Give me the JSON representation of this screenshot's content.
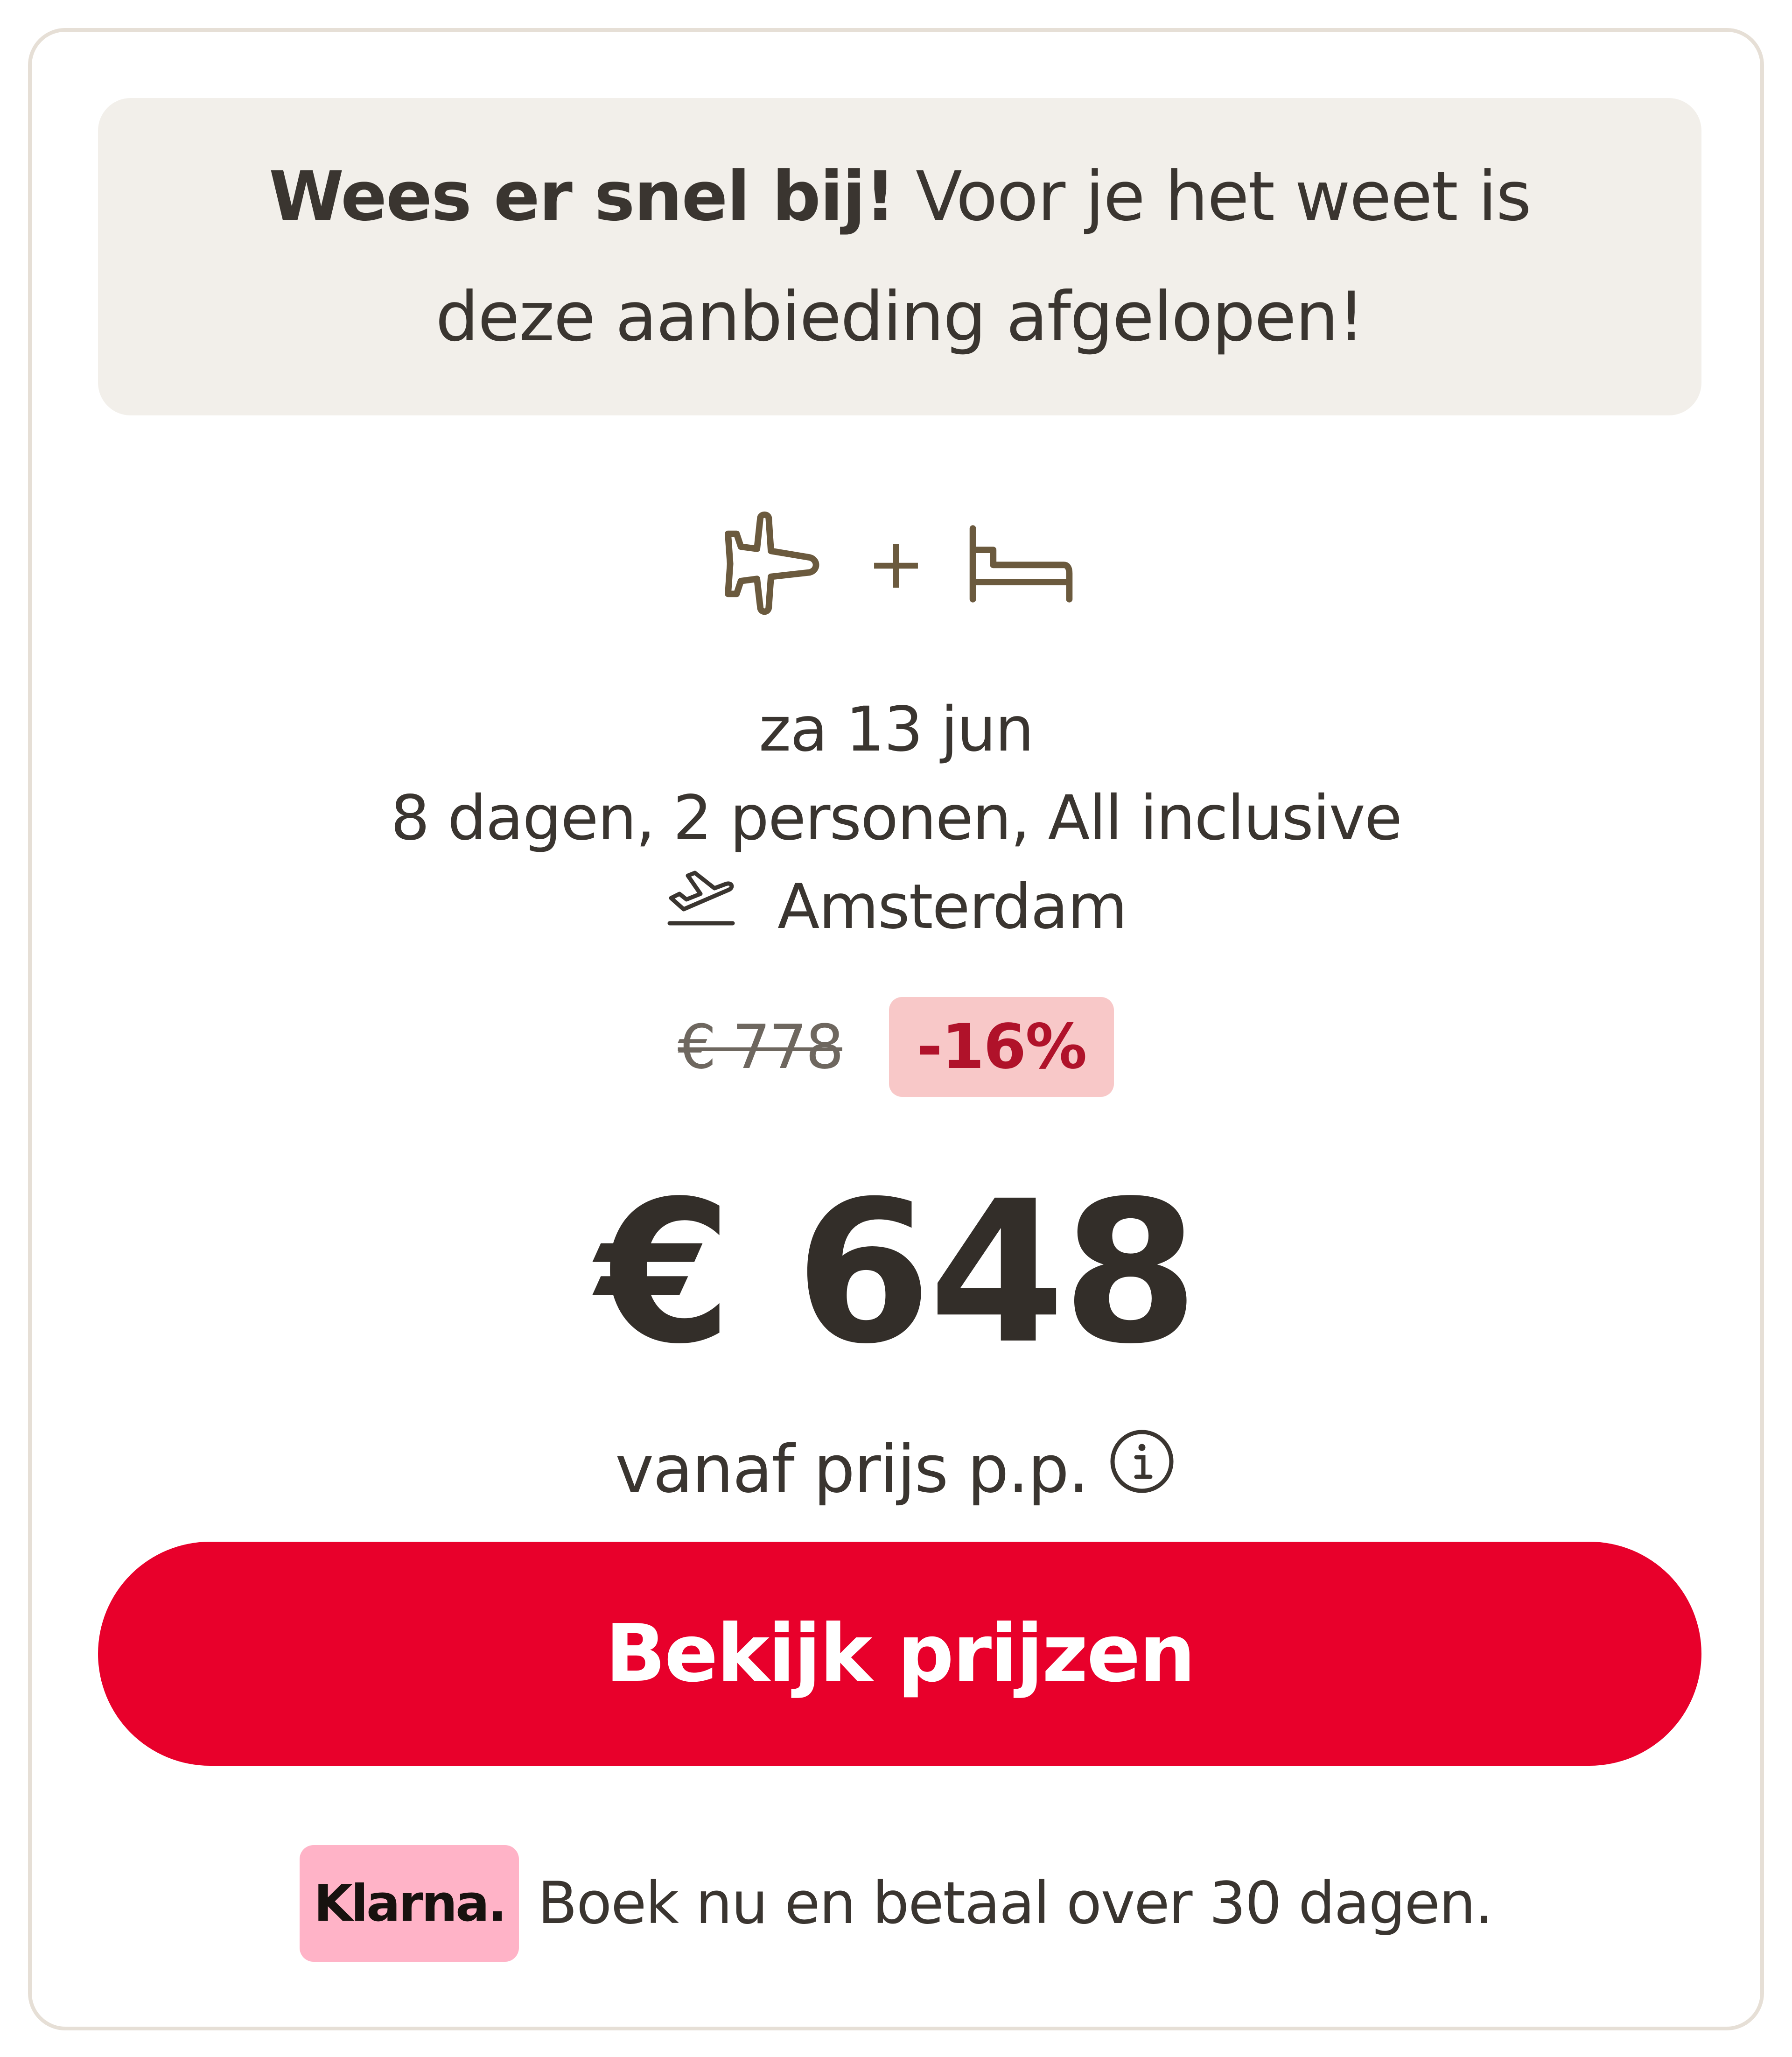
{
  "urgency": {
    "bold": "Wees er snel bij!",
    "text": "Voor je het weet is deze aanbieding afgelopen!"
  },
  "package": {
    "icons": [
      "airplane-icon",
      "bed-icon"
    ],
    "separator": "+"
  },
  "trip": {
    "date": "za 13 jun",
    "details": "8 dagen, 2 personen, All inclusive",
    "departure": "Amsterdam"
  },
  "pricing": {
    "old_price": "€ 778",
    "discount": "-16%",
    "price": "€ 648",
    "note": "vanaf prijs p.p."
  },
  "cta": {
    "label": "Bekijk prijzen"
  },
  "klarna": {
    "logo": "Klarna.",
    "text": "Boek nu en betaal over 30 dagen."
  },
  "colors": {
    "accent": "#e8002b",
    "discount_bg": "#f8c8c8",
    "discount_text": "#b0122a",
    "klarna_pink": "#ffb3c7",
    "icon_brown": "#6b5a3e",
    "banner_bg": "#f2efea"
  }
}
